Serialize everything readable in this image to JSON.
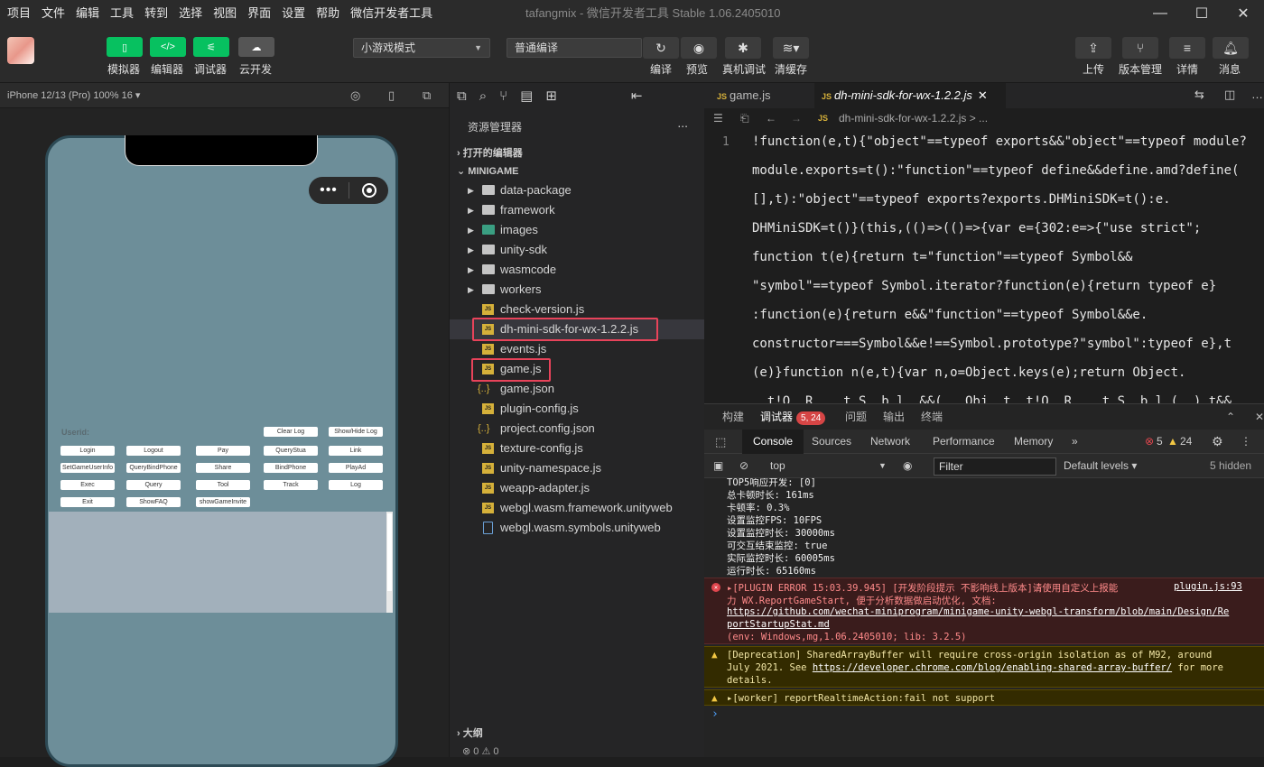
{
  "menu": [
    "项目",
    "文件",
    "编辑",
    "工具",
    "转到",
    "选择",
    "视图",
    "界面",
    "设置",
    "帮助",
    "微信开发者工具"
  ],
  "window_title": "tafangmix - 微信开发者工具 Stable 1.06.2405010",
  "toolbar": {
    "simulator": "模拟器",
    "editor": "编辑器",
    "debugger": "调试器",
    "cloud": "云开发",
    "mode_select": "小游戏模式",
    "compile_select": "普通编译",
    "compile": "编译",
    "preview": "预览",
    "real_debug": "真机调试",
    "clear_cache": "清缓存",
    "upload": "上传",
    "version": "版本管理",
    "details": "详情",
    "messages": "消息"
  },
  "simulator": {
    "device": "iPhone 12/13 (Pro) 100% 16 ▾",
    "userid_label": "Userid:",
    "buttons": [
      [
        "Login",
        "Logout",
        "Pay",
        "QueryStua",
        "Link"
      ],
      [
        "SetGameUserInfo",
        "QueryBindPhone",
        "Share",
        "BindPhone",
        "PlayAd"
      ],
      [
        "Exec",
        "Query",
        "Tool",
        "Track",
        "Log"
      ],
      [
        "Exit",
        "ShowFAQ",
        "showGameInvite"
      ]
    ],
    "top_buttons": [
      "Clear Log",
      "Show/Hide Log"
    ]
  },
  "explorer": {
    "title": "资源管理器",
    "more": "...",
    "open_editors": "打开的编辑器",
    "project": "MINIGAME",
    "folders": [
      "data-package",
      "framework",
      "images",
      "unity-sdk",
      "wasmcode",
      "workers"
    ],
    "files": [
      "check-version.js",
      "dh-mini-sdk-for-wx-1.2.2.js",
      "events.js",
      "game.js",
      "game.json",
      "plugin-config.js",
      "project.config.json",
      "texture-config.js",
      "unity-namespace.js",
      "weapp-adapter.js",
      "webgl.wasm.framework.unityweb",
      "webgl.wasm.symbols.unityweb"
    ],
    "outline": "大纲",
    "status_left": "⊗ 0 ⚠ 0"
  },
  "editor": {
    "tabs": [
      "game.js",
      "dh-mini-sdk-for-wx-1.2.2.js"
    ],
    "breadcrumb": "dh-mini-sdk-for-wx-1.2.2.js > ...",
    "line_number": "1",
    "code_lines": [
      "!function(e,t){\"object\"==typeof exports&&\"object\"==typeof module?",
      "module.exports=t():\"function\"==typeof define&&define.amd?define(",
      "[],t):\"object\"==typeof exports?exports.DHMiniSDK=t():e.",
      "DHMiniSDK=t()}(this,(()=>(()=>{var e={302:e=>{\"use strict\";",
      "function t(e){return t=\"function\"==typeof Symbol&&",
      "\"symbol\"==typeof Symbol.iterator?function(e){return typeof e}",
      ":function(e){return e&&\"function\"==typeof Symbol&&e.",
      "constructor===Symbol&&e!==Symbol.prototype?\"symbol\":typeof e},t",
      "(e)}function n(e,t){var n,o=Object.keys(e);return Object.",
      "  t!O  R    t S  b l  &&(   Obj  t  t!O  R    t S  b l (  ) t&&"
    ]
  },
  "console": {
    "top_tabs": [
      "构建",
      "调试器",
      "问题",
      "输出",
      "终端"
    ],
    "debugger_badge": "5, 24",
    "devtools_tabs": [
      "Console",
      "Sources",
      "Network",
      "Performance",
      "Memory"
    ],
    "more_tabs": "»",
    "error_count": "5",
    "warning_count": "24",
    "context": "top",
    "filter_placeholder": "Filter",
    "levels": "Default levels ▾",
    "hidden": "5 hidden",
    "log_lines": [
      "TOP5响应开发: [0]",
      "总卡顿时长: 161ms",
      "卡顿率: 0.3%",
      "设置监控FPS: 10FPS",
      "设置监控时长: 30000ms",
      "可交互结束监控: true",
      "实际监控时长: 60005ms",
      "运行时长: 65160ms"
    ],
    "error_line1": "▸[PLUGIN ERROR 15:03.39.945] [开发阶段提示 不影响线上版本]请使用自定义上报能",
    "error_link1": "plugin.js:93",
    "error_line2": "力 WX.ReportGameStart, 便于分析数据做启动优化, 文档:",
    "error_url1": "https://github.com/wechat-miniprogram/minigame-unity-webgl-transform/blob/main/Design/Re",
    "error_url2": "portStartupStat.md",
    "error_env": "(env: Windows,mg,1.06.2405010; lib: 3.2.5)",
    "warn1_line1": "[Deprecation] SharedArrayBuffer will require cross-origin isolation as of M92, around",
    "warn1_line2a": "July 2021. See ",
    "warn1_url": "https://developer.chrome.com/blog/enabling-shared-array-buffer/",
    "warn1_line2b": " for more",
    "warn1_line3": "details.",
    "warn2": "▸[worker] reportRealtimeAction:fail not support",
    "prompt": "›"
  }
}
